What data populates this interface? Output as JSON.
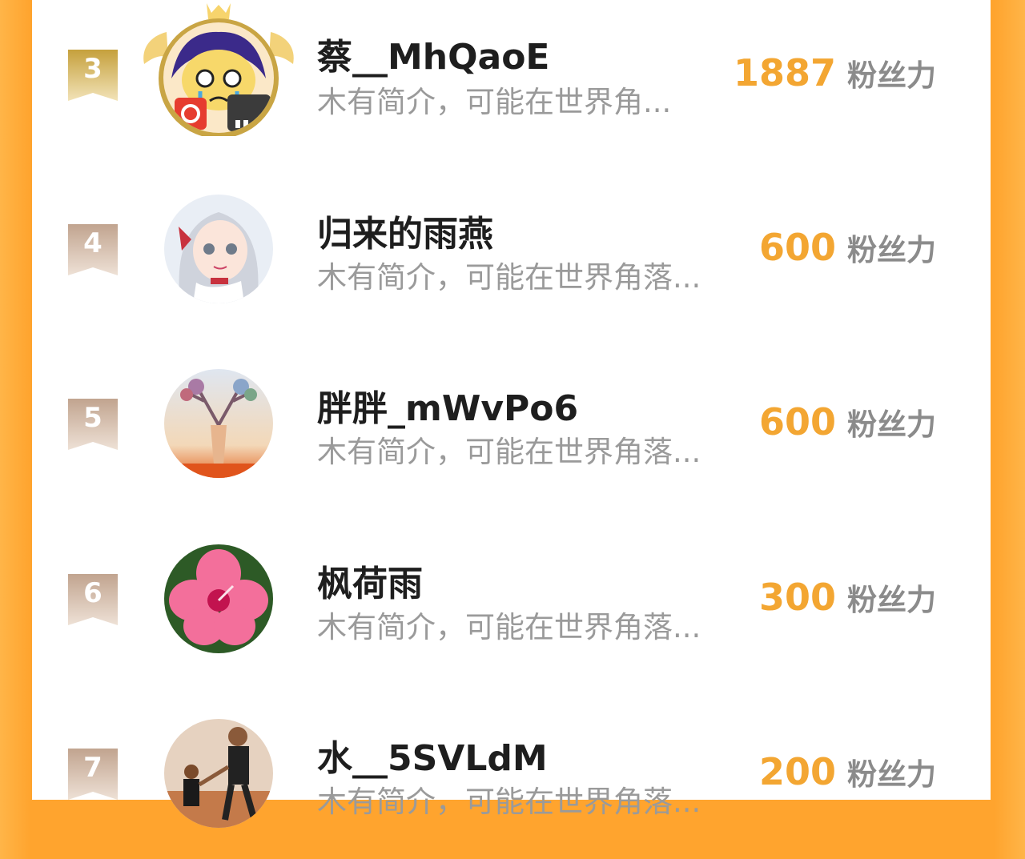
{
  "unit_label": "粉丝力",
  "colors": {
    "accent": "#f3a632",
    "side": "#ffa42e",
    "badge_gold": "#c9a544",
    "badge_bronze": "#c8ad98"
  },
  "rows": [
    {
      "rank": "3",
      "name": "蔡__MhQaoE",
      "desc": "木有简介，可能在世界角...",
      "score": "1887",
      "avatar_icon": "cartoon-character-avatar-with-crown"
    },
    {
      "rank": "4",
      "name": "归来的雨燕",
      "desc": "木有简介，可能在世界角落...",
      "score": "600",
      "avatar_icon": "anime-girl-avatar"
    },
    {
      "rank": "5",
      "name": "胖胖_mWvPo6",
      "desc": "木有简介，可能在世界角落...",
      "score": "600",
      "avatar_icon": "deer-art-avatar"
    },
    {
      "rank": "6",
      "name": "枫荷雨",
      "desc": "木有简介，可能在世界角落...",
      "score": "300",
      "avatar_icon": "pink-flower-avatar"
    },
    {
      "rank": "7",
      "name": "水__5SVLdM",
      "desc": "木有简介，可能在世界角落...",
      "score": "200",
      "avatar_icon": "basketball-photo-avatar"
    }
  ]
}
